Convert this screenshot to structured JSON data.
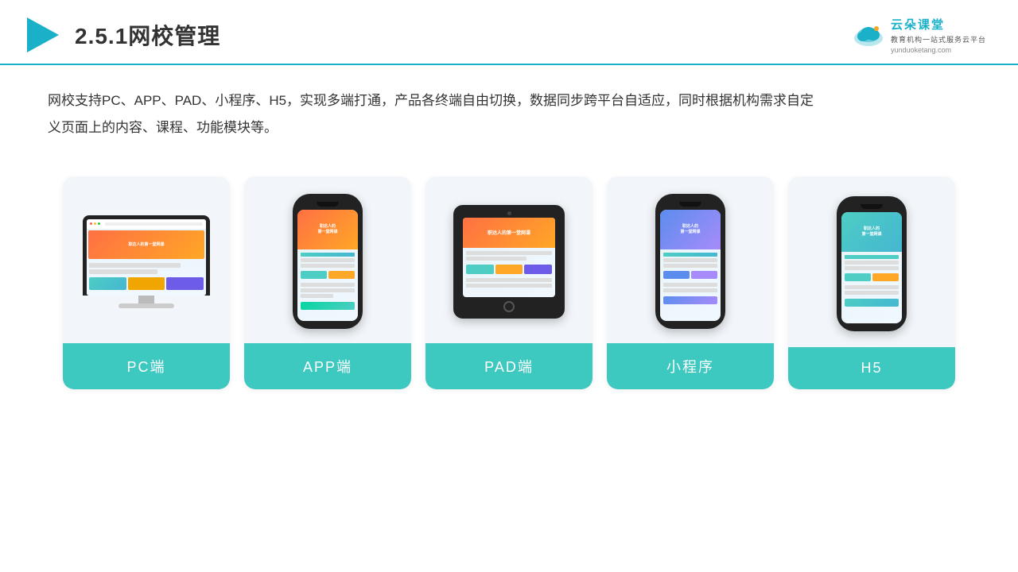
{
  "header": {
    "title": "2.5.1网校管理",
    "brand_name": "云朵课堂",
    "brand_tagline": "教育机构一站\n式服务云平台",
    "brand_url": "yunduoketang.com"
  },
  "description": {
    "text": "网校支持PC、APP、PAD、小程序、H5，实现多端打通，产品各终端自由切换，数据同步跨平台自适应，同时根据机构需求自定义页面上的内容、课程、功能模块等。"
  },
  "cards": [
    {
      "id": "pc",
      "label": "PC端"
    },
    {
      "id": "app",
      "label": "APP端"
    },
    {
      "id": "pad",
      "label": "PAD端"
    },
    {
      "id": "miniapp",
      "label": "小程序"
    },
    {
      "id": "h5",
      "label": "H5"
    }
  ],
  "colors": {
    "accent": "#3dc8c0",
    "header_line": "#1ab0c8",
    "brand": "#1ab0c8"
  }
}
